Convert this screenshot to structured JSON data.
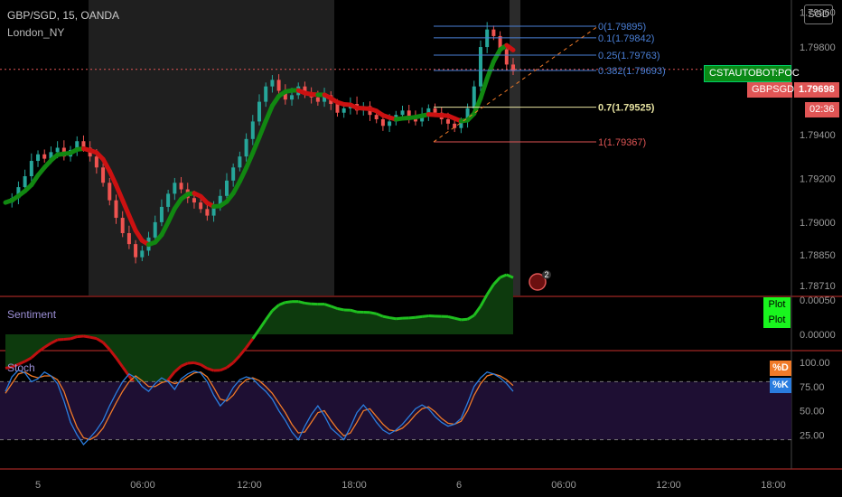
{
  "header": {
    "symbol_title": "GBP/SGD, 15, OANDA",
    "indicator": "London_NY",
    "currency": "SGD"
  },
  "labels": {
    "strategy": "CSTAUTOBOT:POC",
    "symbol": "GBPSGD",
    "price": "1.79698",
    "countdown": "02:36",
    "event_count": "2"
  },
  "colors": {
    "bull": "#26a69a",
    "bear": "#ef5350",
    "ma_up": "#118811",
    "ma_down": "#cc1111",
    "fib": "#4a7fd6",
    "fib_07": "#e7e3a1",
    "fib_1": "#e05555",
    "stoch_k": "#2a7ddf",
    "stoch_d": "#f07a28",
    "sentiment_up": "#1fbf1f",
    "sentiment_down": "#c01010",
    "session": "#1f1f1f",
    "pane_border": "#c9302c"
  },
  "chart_data": [
    {
      "type": "candlestick",
      "name": "GBP/SGD, 15, OANDA",
      "y_ticks": [
        "1.79960",
        "1.79800",
        "1.79600",
        "1.79400",
        "1.79200",
        "1.79000",
        "1.78850",
        "1.78710"
      ],
      "x_ticks": [
        "5",
        "06:00",
        "12:00",
        "18:00",
        "6",
        "06:00",
        "12:00",
        "18:00"
      ],
      "ylim": [
        1.7869,
        1.7999
      ],
      "price_line": 1.79698,
      "fib_levels": [
        {
          "label": "0(1.79895)",
          "value": 1.79895
        },
        {
          "label": "0.1(1.79842)",
          "value": 1.79842
        },
        {
          "label": "0.25(1.79763)",
          "value": 1.79763
        },
        {
          "label": "0.382(1.79693)",
          "value": 1.79693
        },
        {
          "label": "0.7(1.79525)",
          "value": 1.79525
        },
        {
          "label": "1(1.79367)",
          "value": 1.79367
        }
      ],
      "ohlc_series_approx": [
        1.7909,
        1.7911,
        1.7916,
        1.7921,
        1.7928,
        1.7931,
        1.7929,
        1.7932,
        1.7934,
        1.793,
        1.7933,
        1.7937,
        1.7934,
        1.793,
        1.7925,
        1.7918,
        1.791,
        1.7902,
        1.7895,
        1.789,
        1.7884,
        1.7887,
        1.7893,
        1.79,
        1.7907,
        1.7913,
        1.7918,
        1.7915,
        1.7911,
        1.7909,
        1.7906,
        1.7903,
        1.7907,
        1.7912,
        1.7919,
        1.7925,
        1.793,
        1.7938,
        1.7946,
        1.7955,
        1.7962,
        1.7965,
        1.796,
        1.7956,
        1.7958,
        1.7962,
        1.7959,
        1.7957,
        1.7955,
        1.7958,
        1.7954,
        1.795,
        1.7952,
        1.7954,
        1.7951,
        1.7953,
        1.7949,
        1.7947,
        1.7944,
        1.7946,
        1.7949,
        1.7951,
        1.7948,
        1.7946,
        1.7949,
        1.7952,
        1.795,
        1.7947,
        1.7945,
        1.7943,
        1.7946,
        1.7952,
        1.7962,
        1.798,
        1.7988,
        1.7985,
        1.7979,
        1.7972,
        1.7969
      ]
    },
    {
      "type": "area",
      "name": "Sentiment",
      "y_ticks": [
        "0.00050",
        "0.00000"
      ],
      "legend": [
        "Plot",
        "Plot"
      ]
    },
    {
      "type": "line",
      "name": "Stoch",
      "y_ticks": [
        "100.00",
        "75.00",
        "50.00",
        "25.00"
      ],
      "ylim": [
        0,
        100
      ],
      "bands": [
        80,
        20
      ],
      "legend": [
        "%D",
        "%K"
      ],
      "k_values": [
        70,
        85,
        92,
        89,
        80,
        83,
        90,
        86,
        78,
        60,
        38,
        25,
        15,
        22,
        30,
        40,
        55,
        68,
        80,
        88,
        84,
        75,
        70,
        78,
        84,
        80,
        72,
        83,
        88,
        91,
        89,
        80,
        66,
        55,
        62,
        74,
        82,
        85,
        83,
        76,
        70,
        62,
        50,
        40,
        28,
        20,
        34,
        46,
        55,
        45,
        32,
        26,
        20,
        33,
        48,
        56,
        48,
        38,
        30,
        26,
        30,
        36,
        44,
        52,
        56,
        52,
        44,
        38,
        34,
        36,
        42,
        58,
        75,
        84,
        90,
        88,
        84,
        78,
        70
      ],
      "d_values": [
        68,
        78,
        88,
        90,
        86,
        84,
        86,
        86,
        82,
        70,
        50,
        33,
        22,
        20,
        24,
        32,
        45,
        58,
        70,
        80,
        86,
        81,
        75,
        75,
        79,
        81,
        78,
        80,
        85,
        89,
        90,
        85,
        74,
        62,
        60,
        66,
        76,
        82,
        84,
        81,
        75,
        68,
        58,
        48,
        36,
        27,
        28,
        38,
        48,
        50,
        40,
        31,
        24,
        27,
        38,
        50,
        52,
        44,
        36,
        30,
        29,
        32,
        38,
        46,
        52,
        54,
        49,
        42,
        37,
        36,
        39,
        50,
        66,
        78,
        86,
        88,
        86,
        82,
        76
      ]
    }
  ]
}
